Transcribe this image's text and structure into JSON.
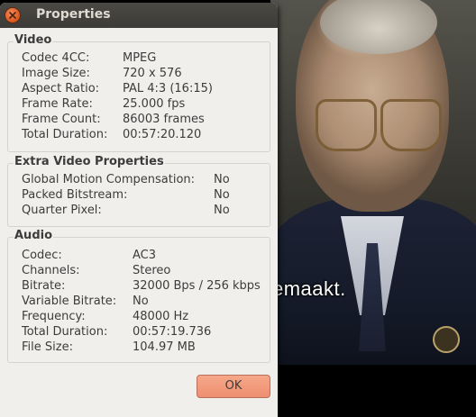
{
  "dialog": {
    "title": "Properties",
    "ok_label": "OK"
  },
  "video_section": {
    "title": "Video",
    "rows": [
      {
        "label": "Codec 4CC:",
        "value": "MPEG"
      },
      {
        "label": "Image Size:",
        "value": "720 x 576"
      },
      {
        "label": "Aspect Ratio:",
        "value": "PAL 4:3 (16:15)"
      },
      {
        "label": "Frame Rate:",
        "value": "25.000 fps"
      },
      {
        "label": "Frame Count:",
        "value": "86003 frames"
      },
      {
        "label": "Total Duration:",
        "value": "00:57:20.120"
      }
    ]
  },
  "extra_section": {
    "title": "Extra Video Properties",
    "rows": [
      {
        "label": "Global Motion Compensation:",
        "value": "No"
      },
      {
        "label": "Packed Bitstream:",
        "value": "No"
      },
      {
        "label": "Quarter Pixel:",
        "value": "No"
      }
    ]
  },
  "audio_section": {
    "title": "Audio",
    "rows": [
      {
        "label": "Codec:",
        "value": "AC3"
      },
      {
        "label": "Channels:",
        "value": "Stereo"
      },
      {
        "label": "Bitrate:",
        "value": "32000 Bps / 256 kbps"
      },
      {
        "label": "Variable Bitrate:",
        "value": "No"
      },
      {
        "label": "Frequency:",
        "value": "48000 Hz"
      },
      {
        "label": "Total Duration:",
        "value": "00:57:19.736"
      },
      {
        "label": "File Size:",
        "value": "104.97 MB"
      }
    ]
  },
  "video_frame": {
    "subtitle": "emaakt."
  },
  "colors": {
    "titlebar": "#3c3b37",
    "close_button": "#e05d24",
    "ok_button": "#f09a7a",
    "dialog_bg": "#f1efec"
  }
}
